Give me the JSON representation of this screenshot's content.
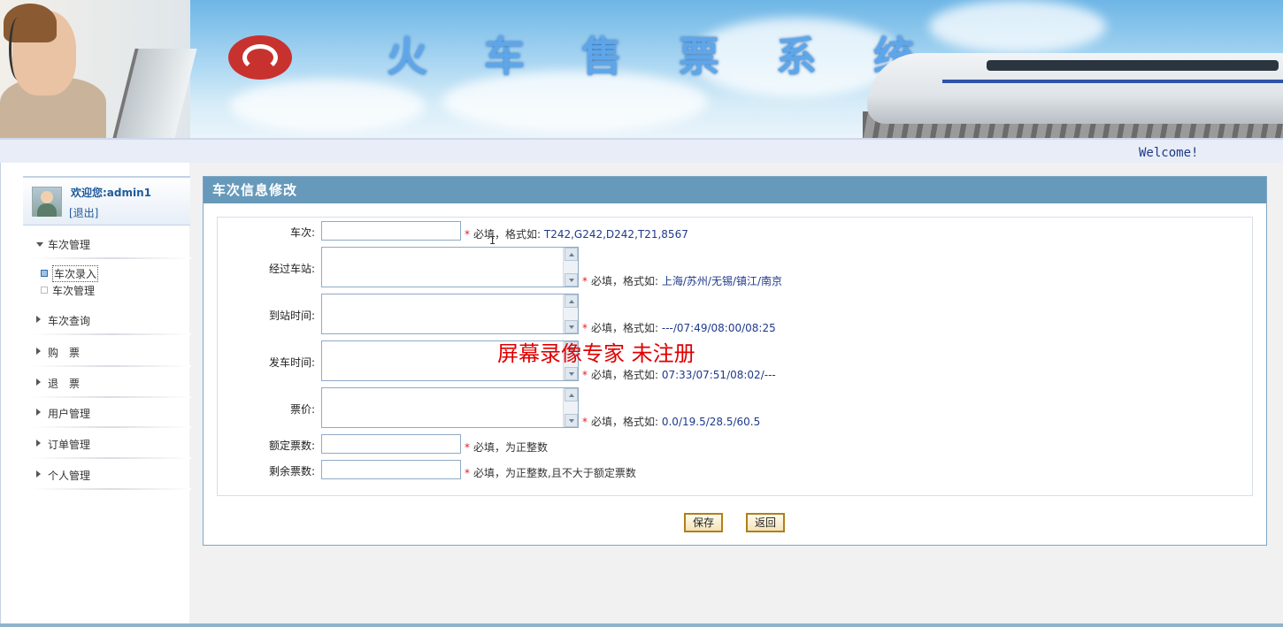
{
  "banner": {
    "system_title_chars": [
      "火",
      "车",
      "售",
      "票",
      "系",
      "统"
    ],
    "welcome_text": "Welcome!"
  },
  "sidebar": {
    "user_greeting": "欢迎您:admin1",
    "logout_label": "[退出]",
    "menu": [
      {
        "label": "车次管理",
        "expanded": true
      },
      {
        "label": "车次查询",
        "expanded": false
      },
      {
        "label": "购　票",
        "expanded": false
      },
      {
        "label": "退　票",
        "expanded": false
      },
      {
        "label": "用户管理",
        "expanded": false
      },
      {
        "label": "订单管理",
        "expanded": false
      },
      {
        "label": "个人管理",
        "expanded": false
      }
    ],
    "submenu": [
      {
        "label": "车次录入",
        "active": true
      },
      {
        "label": "车次管理",
        "active": false
      }
    ]
  },
  "main": {
    "panel_title": "车次信息修改",
    "fields": [
      {
        "label": "车次:",
        "value": "",
        "required": "*",
        "hint": "必填，格式如: ",
        "format": "T242,G242,D242,T21,8567"
      },
      {
        "label": "经过车站:",
        "value": "",
        "required": "*",
        "hint": "必填，格式如: ",
        "format": "上海/苏州/无锡/镇江/南京"
      },
      {
        "label": "到站时间:",
        "value": "",
        "required": "*",
        "hint": "必填，格式如: ",
        "format": "---/07:49/08:00/08:25"
      },
      {
        "label": "发车时间:",
        "value": "",
        "required": "*",
        "hint": "必填，格式如: ",
        "format": "07:33/07:51/08:02/---"
      },
      {
        "label": "票价:",
        "value": "",
        "required": "*",
        "hint": "必填，格式如: ",
        "format": "0.0/19.5/28.5/60.5"
      },
      {
        "label": "额定票数:",
        "value": "",
        "required": "*",
        "hint": "必填，为正整数",
        "format": ""
      },
      {
        "label": "剩余票数:",
        "value": "",
        "required": "*",
        "hint": "必填，为正整数,且不大于额定票数",
        "format": ""
      }
    ],
    "save_label": "保存",
    "back_label": "返回",
    "watermark": "屏幕录像专家  未注册",
    "cursor_glyph": "I"
  },
  "colors": {
    "panel_header": "#6799ba",
    "required_star": "#e02020",
    "format_text": "#1e3a8a",
    "watermark": "#e00000"
  }
}
